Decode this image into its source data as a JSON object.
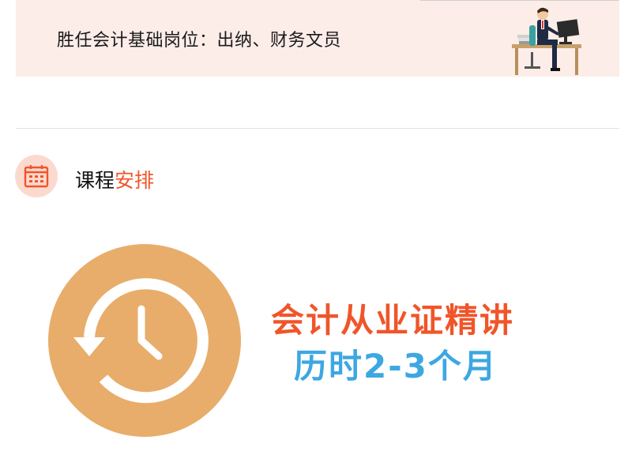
{
  "banner": {
    "text": "胜任会计基础岗位：出纳、财务文员"
  },
  "section": {
    "title_part1": "课程",
    "title_part2": "安排"
  },
  "promo": {
    "line1": "会计从业证精讲",
    "line2": "历时2-3个月"
  },
  "icons": {
    "calendar": "calendar-icon",
    "clock": "history-clock-icon",
    "illustration": "office-worker-illustration"
  },
  "colors": {
    "accent_orange": "#f0552a",
    "accent_blue": "#3da7e2",
    "clock_circle": "#e8ad6b",
    "banner_bg": "#fcede8",
    "icon_circle": "#fcd9cf"
  }
}
